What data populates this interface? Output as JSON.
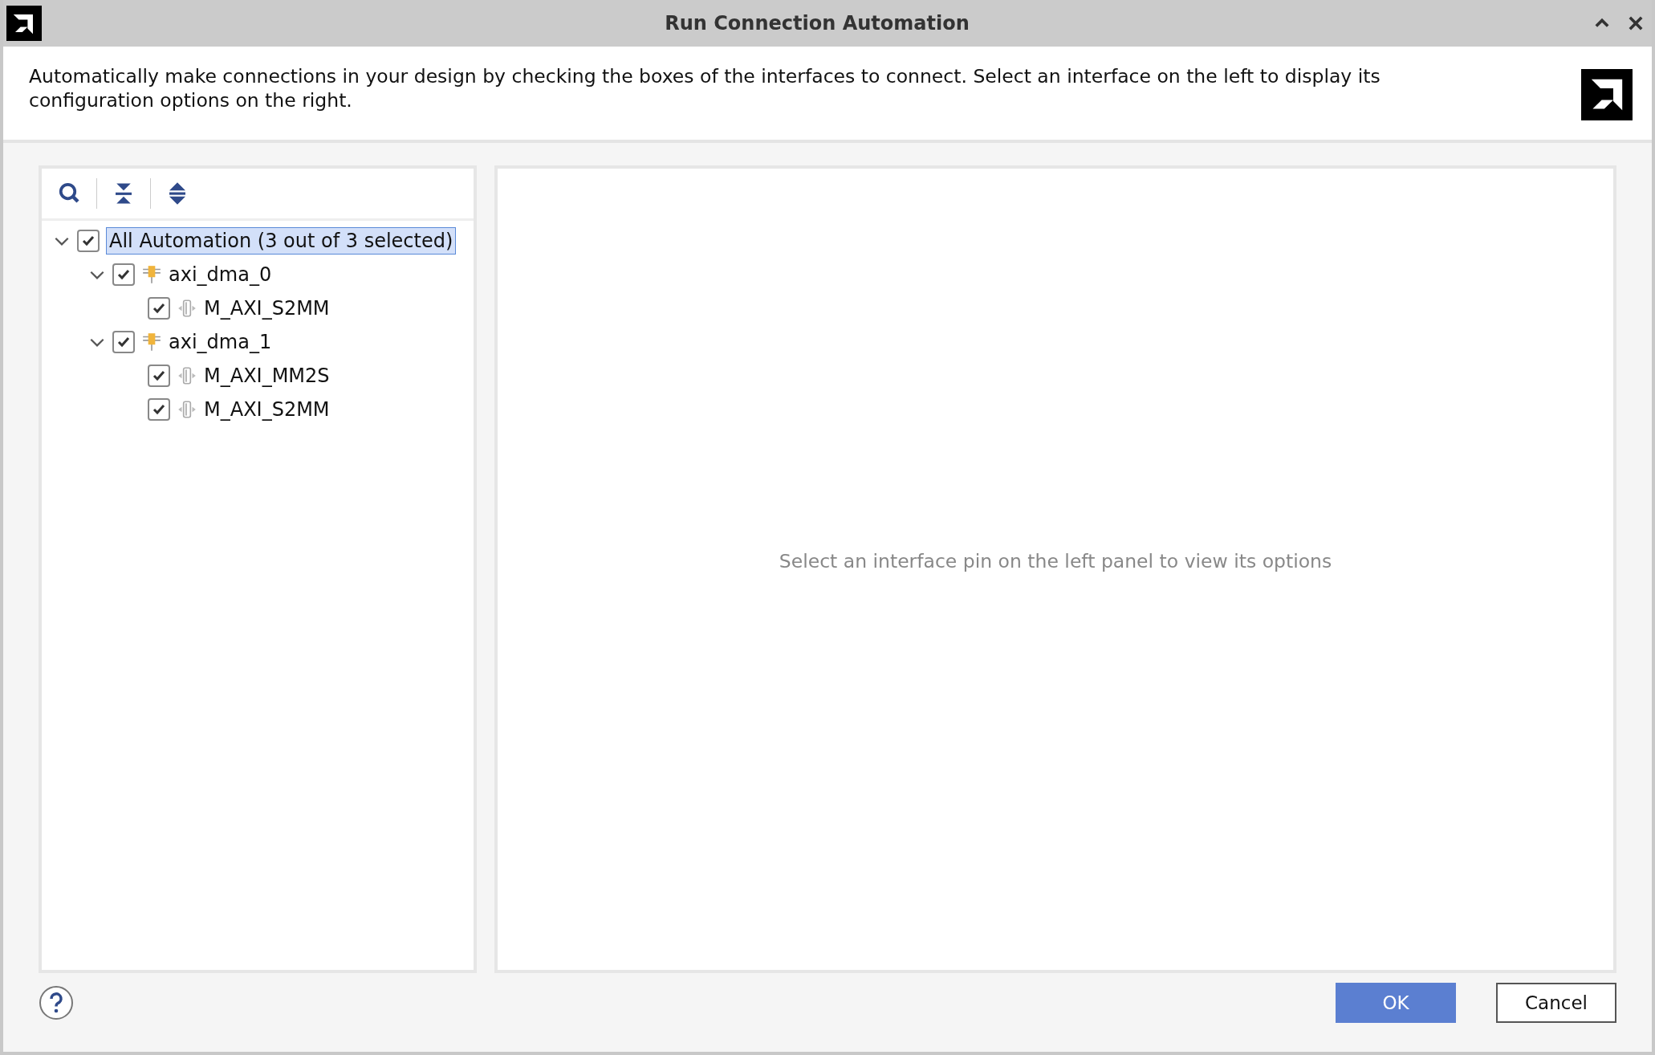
{
  "window": {
    "title": "Run Connection Automation"
  },
  "description": "Automatically make connections in your design by checking the boxes of the interfaces to connect. Select an interface on the left to display its configuration options on the right.",
  "tree": [
    {
      "label": "All Automation (3 out of 3 selected)",
      "checked": true,
      "expanded": true,
      "selected": true,
      "children": [
        {
          "label": "axi_dma_0",
          "kind": "block",
          "checked": true,
          "expanded": true,
          "selected": false,
          "children": [
            {
              "label": "M_AXI_S2MM",
              "kind": "interface",
              "checked": true,
              "selected": false
            }
          ]
        },
        {
          "label": "axi_dma_1",
          "kind": "block",
          "checked": true,
          "expanded": true,
          "selected": false,
          "children": [
            {
              "label": "M_AXI_MM2S",
              "kind": "interface",
              "checked": true,
              "selected": false
            },
            {
              "label": "M_AXI_S2MM",
              "kind": "interface",
              "checked": true,
              "selected": false
            }
          ]
        }
      ]
    }
  ],
  "options_hint": "Select an interface pin on the left panel to view its options",
  "buttons": [
    {
      "label": "OK",
      "kind": "primary"
    },
    {
      "label": "Cancel",
      "kind": "secondary"
    }
  ]
}
